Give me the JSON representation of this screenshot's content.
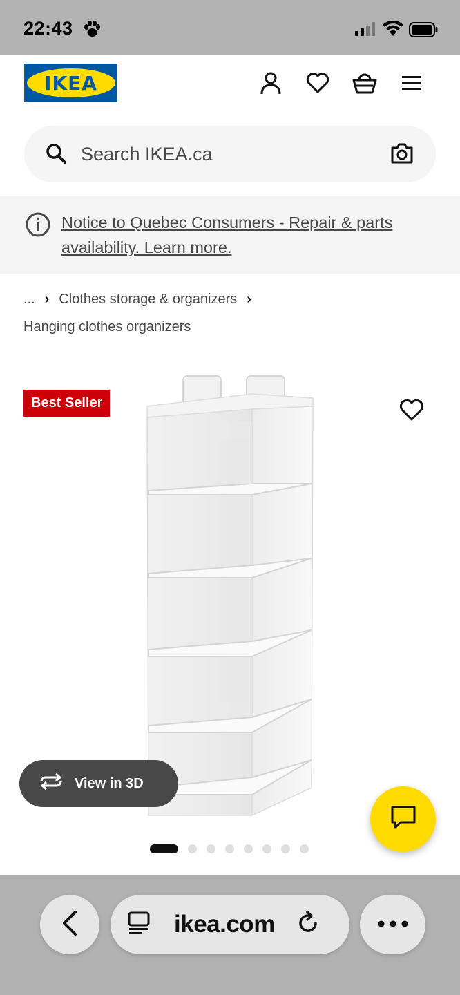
{
  "status_bar": {
    "time": "22:43"
  },
  "header": {
    "logo_text": "IKEA",
    "icons": [
      "account-icon",
      "heart-icon",
      "basket-icon",
      "menu-icon"
    ]
  },
  "search": {
    "placeholder": "Search IKEA.ca"
  },
  "notice": {
    "text": "Notice to Quebec Consumers - Repair & parts availability. Learn more."
  },
  "breadcrumb": {
    "ellipsis": "...",
    "items": [
      "Clothes storage & organizers",
      "Hanging clothes organizers"
    ]
  },
  "product": {
    "badge": "Best Seller",
    "view_3d_label": "View in 3D",
    "image_count": 8,
    "active_image": 1
  },
  "browser": {
    "url": "ikea.com"
  },
  "colors": {
    "ikea_blue": "#0058a3",
    "ikea_yellow": "#ffdb00",
    "badge_red": "#cc0008"
  }
}
